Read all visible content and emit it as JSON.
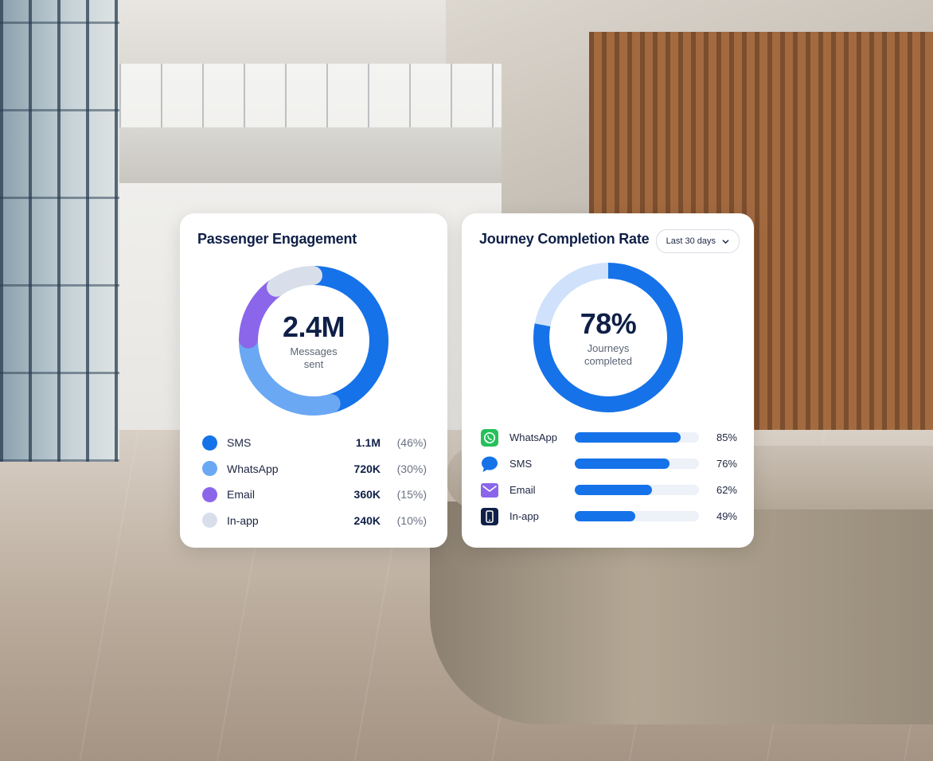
{
  "cards": {
    "engagement": {
      "title": "Passenger Engagement",
      "center_value": "2.4M",
      "center_caption": "Messages sent"
    },
    "completion": {
      "title": "Journey Completion Rate",
      "period_select": "Last 30 days",
      "center_value": "78%",
      "center_caption": "Journeys completed"
    }
  },
  "chart_data": [
    {
      "type": "pie",
      "variant": "donut",
      "title": "Passenger Engagement",
      "center": {
        "value": "2.4M",
        "caption": "Messages sent"
      },
      "slices": [
        {
          "label": "SMS",
          "value": 1.1,
          "value_text": "1.1M",
          "pct": 46,
          "pct_text": "(46%)",
          "color": "#1672e8"
        },
        {
          "label": "WhatsApp",
          "value": 0.72,
          "value_text": "720K",
          "pct": 30,
          "pct_text": "(30%)",
          "color": "#6aa8f3"
        },
        {
          "label": "Email",
          "value": 0.36,
          "value_text": "360K",
          "pct": 15,
          "pct_text": "(15%)",
          "color": "#8b66ea"
        },
        {
          "label": "In-app",
          "value": 0.24,
          "value_text": "240K",
          "pct": 10,
          "pct_text": "(10%)",
          "color": "#d8dfeb"
        }
      ]
    },
    {
      "type": "pie",
      "variant": "progress-donut",
      "title": "Journey Completion Rate",
      "value": 78,
      "center": {
        "value": "78%",
        "caption": "Journeys completed"
      },
      "colors": {
        "fill": "#1672e8",
        "track": "#cfe1fb"
      }
    },
    {
      "type": "bar",
      "orientation": "horizontal",
      "categories": [
        "WhatsApp",
        "SMS",
        "Email",
        "In-app"
      ],
      "values": [
        85,
        76,
        62,
        49
      ],
      "value_labels": [
        "85%",
        "76%",
        "62%",
        "49%"
      ],
      "icons": [
        "whatsapp-icon",
        "chat-bubble-icon",
        "envelope-icon",
        "phone-icon"
      ],
      "icon_colors": [
        "#25c05a",
        "#1672e8",
        "#8b66ea",
        "#0f1f47"
      ],
      "xlim": [
        0,
        100
      ],
      "color": "#1672e8"
    }
  ]
}
